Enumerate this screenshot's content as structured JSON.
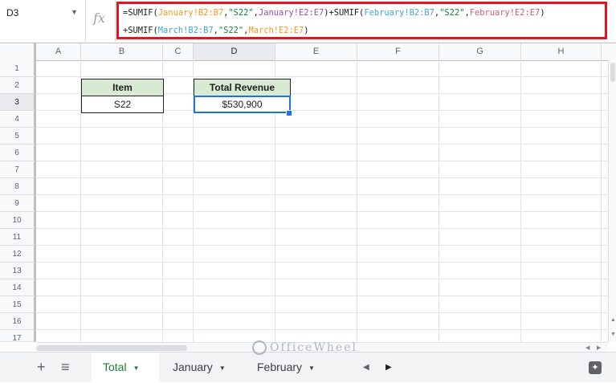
{
  "formula_bar": {
    "name_box": "D3",
    "fx_label": "fx",
    "formula_line1": [
      {
        "t": "=SUMIF(",
        "c": ""
      },
      {
        "t": "January!B2:B7",
        "c": "c-orange"
      },
      {
        "t": ",",
        "c": ""
      },
      {
        "t": "\"S22\"",
        "c": "c-green"
      },
      {
        "t": ",",
        "c": ""
      },
      {
        "t": "January!E2:E7",
        "c": "c-purple"
      },
      {
        "t": ")+SUMIF(",
        "c": ""
      },
      {
        "t": "February!B2:B7",
        "c": "c-blue"
      },
      {
        "t": ",",
        "c": ""
      },
      {
        "t": "\"S22\"",
        "c": "c-green"
      },
      {
        "t": ",",
        "c": ""
      },
      {
        "t": "February!E2:E7",
        "c": "c-pink"
      },
      {
        "t": ")",
        "c": ""
      }
    ],
    "formula_line2": [
      {
        "t": "+SUMIF(",
        "c": ""
      },
      {
        "t": "March!B2:B7",
        "c": "c-blue"
      },
      {
        "t": ",",
        "c": ""
      },
      {
        "t": "\"S22\"",
        "c": "c-green"
      },
      {
        "t": ",",
        "c": ""
      },
      {
        "t": "March!E2:E7",
        "c": "c-orange"
      },
      {
        "t": ")",
        "c": ""
      }
    ],
    "highlight_color": "#e8131f"
  },
  "columns": [
    "A",
    "B",
    "C",
    "D",
    "E",
    "F",
    "G",
    "H"
  ],
  "selected_column": "D",
  "rows": [
    "1",
    "2",
    "3",
    "4",
    "5",
    "6",
    "7",
    "8",
    "9",
    "10",
    "11",
    "12",
    "13",
    "14",
    "15",
    "16",
    "17"
  ],
  "selected_row": "3",
  "cells": {
    "B2": "Item",
    "D2": "Total Revenue",
    "B3": "S22",
    "D3": "$530,900"
  },
  "colors": {
    "header_fill": "#d9ead3",
    "selection": "#1a73e8",
    "active_tab": "#188038"
  },
  "tabs": {
    "add_icon": "+",
    "menu_icon": "≡",
    "items": [
      {
        "label": "Total",
        "active": true
      },
      {
        "label": "January",
        "active": false
      },
      {
        "label": "February",
        "active": false
      }
    ],
    "scroll_left": "◀",
    "scroll_right": "▶",
    "explore_icon": "✦"
  },
  "watermark": "OfficeWheel"
}
